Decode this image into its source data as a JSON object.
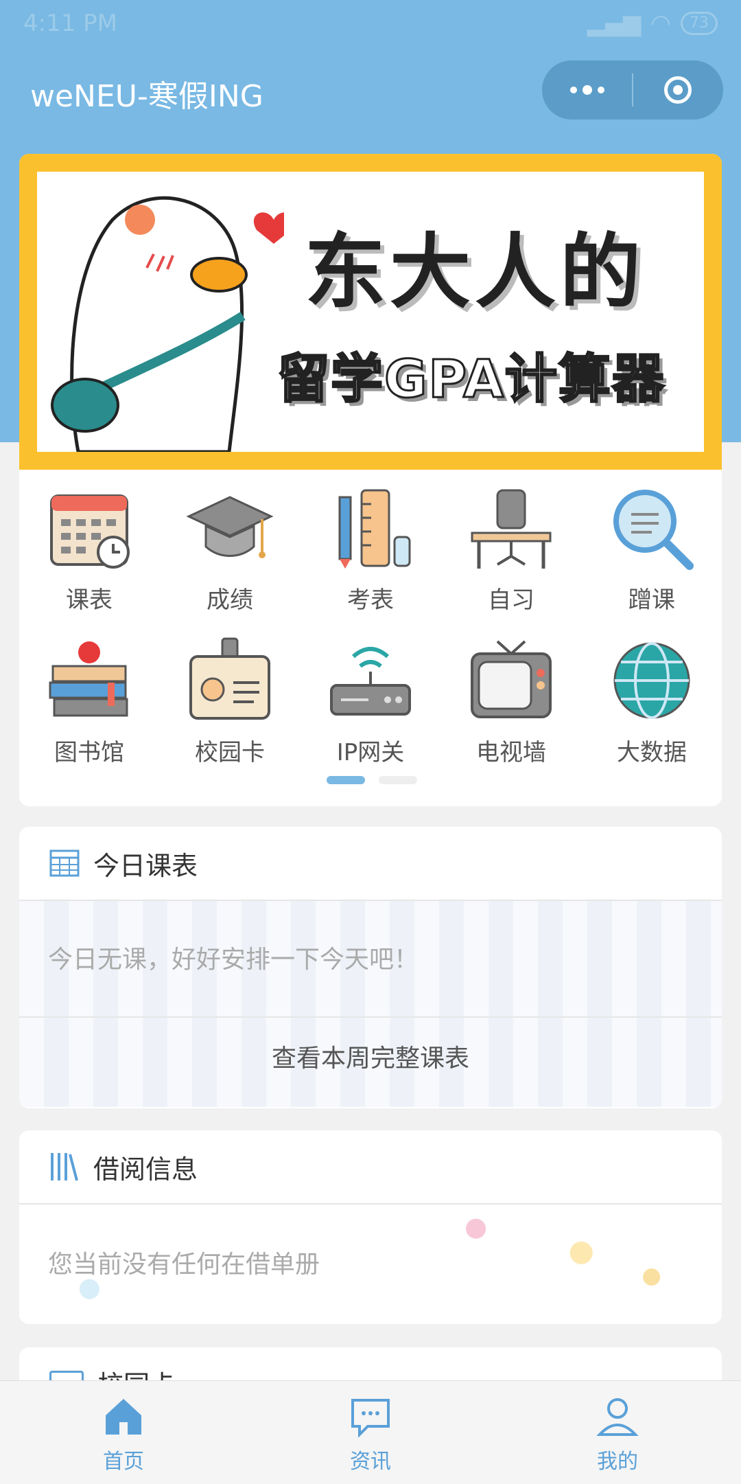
{
  "status": {
    "time": "4:11 PM",
    "battery": "73"
  },
  "nav": {
    "title": "weNEU-寒假ING"
  },
  "banner": {
    "line1": "东大人的",
    "line2": "留学GPA计算器"
  },
  "grid": [
    {
      "label": "课表",
      "icon": "calendar-icon"
    },
    {
      "label": "成绩",
      "icon": "graduation-cap-icon"
    },
    {
      "label": "考表",
      "icon": "pencil-ruler-icon"
    },
    {
      "label": "自习",
      "icon": "chair-desk-icon"
    },
    {
      "label": "蹭课",
      "icon": "magnifier-icon"
    },
    {
      "label": "图书馆",
      "icon": "books-icon"
    },
    {
      "label": "校园卡",
      "icon": "id-card-icon"
    },
    {
      "label": "IP网关",
      "icon": "router-icon"
    },
    {
      "label": "电视墙",
      "icon": "tv-icon"
    },
    {
      "label": "大数据",
      "icon": "globe-icon"
    }
  ],
  "today": {
    "title": "今日课表",
    "empty": "今日无课，好好安排一下今天吧！",
    "link": "查看本周完整课表"
  },
  "borrow": {
    "title": "借阅信息",
    "empty": "您当前没有任何在借单册"
  },
  "card": {
    "title": "校园卡"
  },
  "tabbar": [
    {
      "label": "首页",
      "icon": "home-icon",
      "active": true
    },
    {
      "label": "资讯",
      "icon": "message-icon",
      "active": false
    },
    {
      "label": "我的",
      "icon": "user-icon",
      "active": false
    }
  ],
  "colors": {
    "primary": "#79b9e4",
    "banner_border": "#fbc02d"
  }
}
